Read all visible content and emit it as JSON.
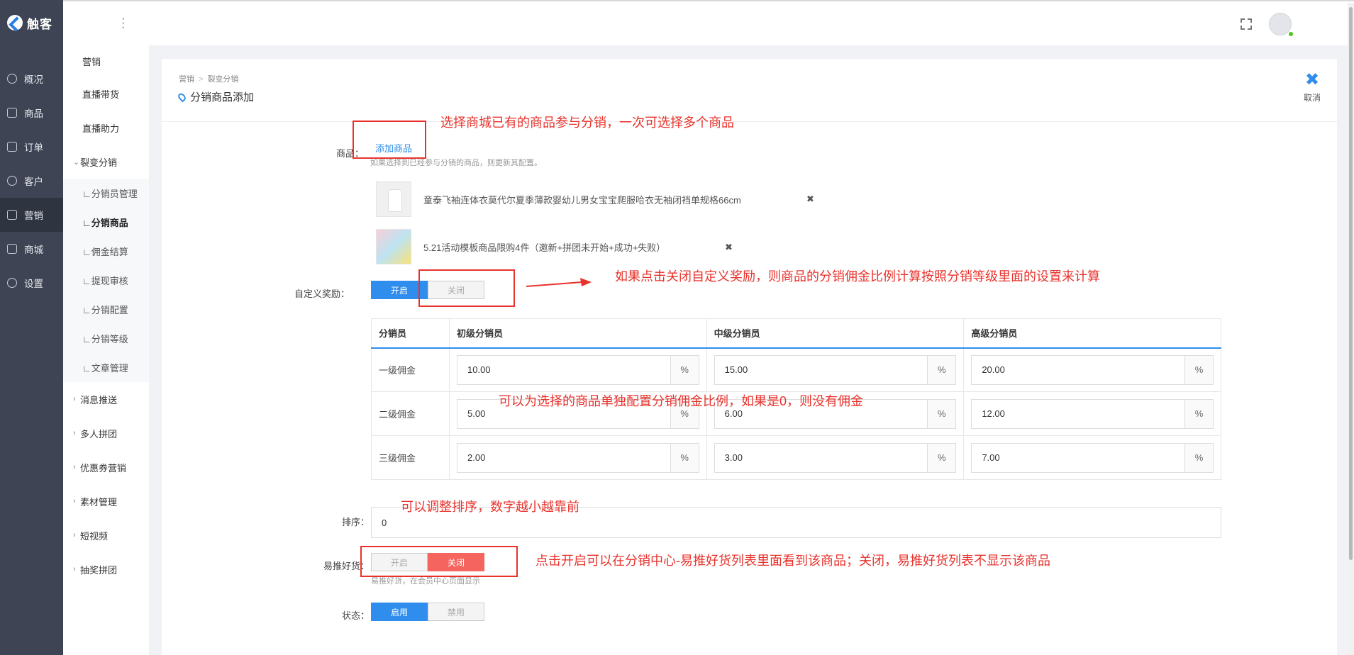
{
  "nav": {
    "brand": "触客",
    "items": [
      {
        "label": "概况",
        "icon": "dashboard-icon"
      },
      {
        "label": "商品",
        "icon": "grid-icon"
      },
      {
        "label": "订单",
        "icon": "calendar-icon"
      },
      {
        "label": "客户",
        "icon": "user-icon"
      },
      {
        "label": "营销",
        "icon": "tag-icon"
      },
      {
        "label": "商城",
        "icon": "shop-icon"
      },
      {
        "label": "设置",
        "icon": "gear-icon"
      }
    ]
  },
  "subnav": {
    "items": [
      "营销",
      "直播带货",
      "直播助力"
    ],
    "group": "裂变分销",
    "children": [
      "∟分销员管理",
      "∟分销商品",
      "∟佣金结算",
      "∟提现审核",
      "∟分销配置",
      "∟分销等级",
      "∟文章管理"
    ],
    "more": [
      "消息推送",
      "多人拼团",
      "优惠券营销",
      "素材管理",
      "短视频",
      "抽奖拼团"
    ]
  },
  "page": {
    "breadcrumb": [
      "营销",
      "裂变分销"
    ],
    "title": "分销商品添加",
    "cancel_label": "取消"
  },
  "form": {
    "product_label": "商品：",
    "add_product": "添加商品",
    "product_hint": "如果选择到已经参与分销的商品，则更新其配置。",
    "products": [
      "童泰飞袖连体衣莫代尔夏季薄款婴幼儿男女宝宝爬服哈衣无袖闭裆单规格66cm",
      "5.21活动模板商品限购4件（邀新+拼团未开始+成功+失败）"
    ],
    "custom_reward_label": "自定义奖励：",
    "on": "开启",
    "off": "关闭",
    "table": {
      "headers": [
        "分销员",
        "初级分销员",
        "中级分销员",
        "高级分销员"
      ],
      "unit": "%",
      "rows": [
        {
          "label": "一级佣金",
          "values": [
            "10.00",
            "15.00",
            "20.00"
          ]
        },
        {
          "label": "二级佣金",
          "values": [
            "5.00",
            "6.00",
            "12.00"
          ]
        },
        {
          "label": "三级佣金",
          "values": [
            "2.00",
            "3.00",
            "7.00"
          ]
        }
      ]
    },
    "sort_label": "排序：",
    "sort_value": "0",
    "recommend_label": "易推好货：",
    "recommend_hint": "易推好货，在会员中心页面显示",
    "status_label": "状态：",
    "enable": "启用",
    "disable": "禁用"
  },
  "annotations": [
    "选择商城已有的商品参与分销，一次可选择多个商品",
    "如果点击关闭自定义奖励，则商品的分销佣金比例计算按照分销等级里面的设置来计算",
    "可以为选择的商品单独配置分销佣金比例，如果是0，则没有佣金",
    "可以调整排序，数字越小越靠前",
    "点击开启可以在分销中心-易推好货列表里面看到该商品；关闭，易推好货列表不显示该商品"
  ],
  "colors": {
    "accent": "#2e8ded",
    "danger": "#f5645f",
    "annotation": "#e8322c",
    "nav_bg": "#3e4453"
  }
}
